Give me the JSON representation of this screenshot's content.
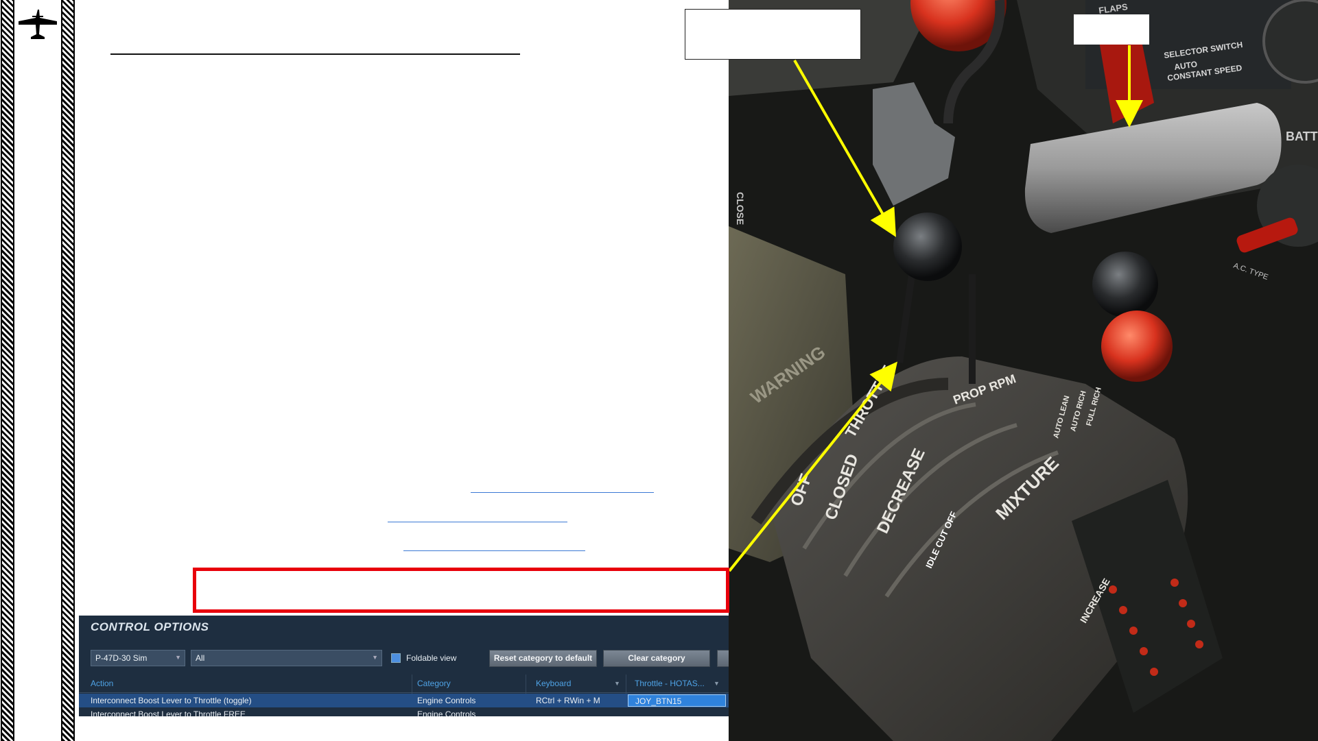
{
  "colors": {
    "red_highlight": "#e8000b",
    "callout_arrow": "#ffff00",
    "panel_bg": "#1e2e40",
    "selected_row": "#244e85",
    "header_text": "#4fa3e6"
  },
  "icons": {
    "logo": "airplane-silhouette-icon"
  },
  "photo": {
    "labels": {
      "selector_switch": "SELECTOR SWITCH",
      "auto": "AUTO",
      "constant_speed": "CONSTANT SPEED",
      "warning": "WARNING",
      "throttle": "THROTTLE",
      "prop_rpm": "PROP RPM",
      "decrease": "DECREASE",
      "closed": "CLOSED",
      "off": "OFF",
      "mixture": "MIXTURE",
      "auto_lean": "AUTO LEAN",
      "auto_rich": "AUTO RICH",
      "full_rich": "FULL RICH",
      "idle_cut_off": "IDLE CUT OFF",
      "increase": "INCREASE",
      "batt": "BATT",
      "flaps": "FLAPS",
      "close": "CLOSE",
      "ac_type": "A.C. TYPE"
    }
  },
  "control_options": {
    "title": "CONTROL OPTIONS",
    "aircraft_select": "P-47D-30 Sim",
    "category_filter": "All",
    "foldable_label": "Foldable view",
    "reset_button": "Reset category to default",
    "clear_button": "Clear category",
    "headers": {
      "action": "Action",
      "category": "Category",
      "keyboard": "Keyboard",
      "device": "Throttle - HOTAS..."
    },
    "rows": [
      {
        "action": "Interconnect Boost Lever to Throttle (toggle)",
        "category": "Engine Controls",
        "keyboard": "RCtrl + RWin + M",
        "device": "JOY_BTN15"
      },
      {
        "action": "Interconnect Boost Lever to Throttle FREE",
        "category": "Engine Controls",
        "keyboard": "",
        "device": ""
      }
    ]
  }
}
